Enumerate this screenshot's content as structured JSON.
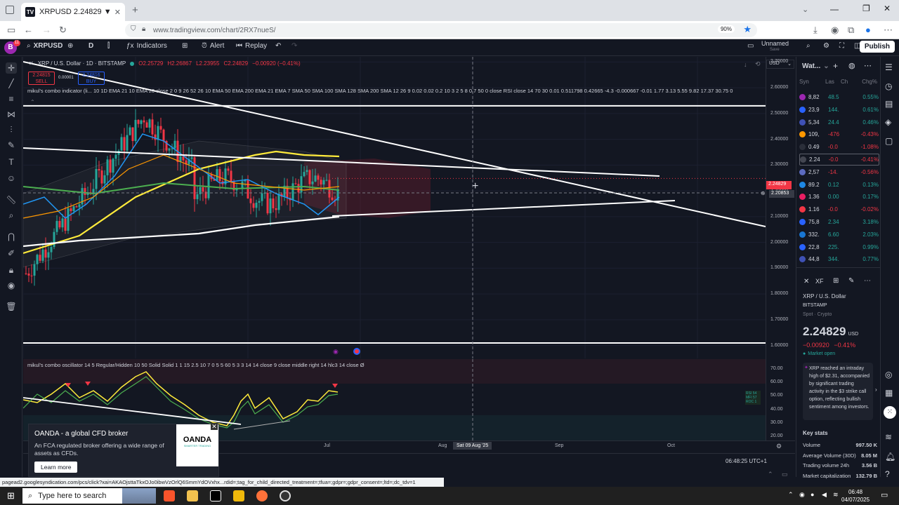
{
  "browser": {
    "tab_title": "XRPUSD 2.24829 ▼ −0.41% Un",
    "url": "www.tradingview.com/chart/2RX7nueS/",
    "zoom": "90%"
  },
  "toolbar": {
    "symbol": "XRPUSD",
    "interval": "D",
    "indicators": "Indicators",
    "alert": "Alert",
    "replay": "Replay",
    "layout_name": "Unnamed",
    "layout_sub": "Save",
    "publish": "Publish",
    "avatar": "B"
  },
  "legend": {
    "symbol_line": "XRP / U.S. Dollar · 1D · BITSTAMP",
    "o": "O2.25729",
    "h": "H2.26867",
    "l": "L2.23955",
    "c": "C2.24829",
    "chg": "−0.00920 (−0.41%)",
    "sell_price": "2.24815",
    "sell_label": "SELL",
    "spread": "0.00001",
    "buy_price": "2.24816",
    "buy_label": "BUY",
    "indicator": "mikul's combo indicator (li... 10 1D EMA 21 10 EMA 20 close 2 0 9 26 52 26 10 EMA 50 EMA 200 EMA 21 EMA 7 SMA 50 SMA 100 SMA 128 SMA 200 SMA 12 26 9 0.02 0.02 0.2 10 3 2 5 8 0.7 50 0 close RSI close 14 70 30 0.01 0.511798 0.42665 -4.3 -0.000667 -0.01 1.77 3.13 5.55 9.82 17.37 30.75 0",
    "oscillator": "mikul's combo oscillator 14 5 Regular/Hidden 10 50 Solid Solid 1 1 15 2.5 10 7 0 5 5 60 5 3 3 14 14 close 9 close middle right 14 hlc3 14 close  Ø",
    "currency": "USD",
    "osc_table": [
      "RSI  54",
      "MFI  57",
      "ROC  1"
    ]
  },
  "price_axis": {
    "labels": [
      "2.70000",
      "2.60000",
      "2.50000",
      "2.40000",
      "2.30000",
      "2.20000",
      "2.10000",
      "2.00000",
      "1.90000",
      "1.80000",
      "1.70000",
      "1.60000"
    ],
    "current": "2.24829",
    "crosshair": "2.20853",
    "osc_labels": [
      "70.00",
      "60.00",
      "50.00",
      "40.00",
      "30.00",
      "20.00"
    ]
  },
  "time_axis": {
    "labels": [
      "Jul",
      "Aug",
      "Sep",
      "Oct"
    ],
    "crosshair": "Sat 09 Aug '25",
    "clock": "06:48:25 UTC+1"
  },
  "chart_data": {
    "type": "line",
    "title": "XRP / U.S. Dollar · 1D · BITSTAMP",
    "ylim": [
      1.55,
      2.72
    ],
    "y_ticks": [
      2.7,
      2.6,
      2.5,
      2.4,
      2.3,
      2.2,
      2.1,
      2.0,
      1.9,
      1.8,
      1.7,
      1.6
    ],
    "x_ticks": [
      "Jul",
      "Aug",
      "Sep",
      "Oct"
    ],
    "horizontal_lines": [
      2.53,
      1.61
    ],
    "last_price": 2.24829
  },
  "watchlist": {
    "title": "Wat...",
    "headers": [
      "Syn",
      "Las",
      "Ch",
      "Chg%"
    ],
    "rows": [
      {
        "sym": "8,82",
        "last": "48.5",
        "chg": "0.55%",
        "color": "#9c27b0",
        "up": true
      },
      {
        "sym": "23,9",
        "last": "144.",
        "chg": "0.61%",
        "color": "#2962ff",
        "up": true
      },
      {
        "sym": "5,34",
        "last": "24.4",
        "chg": "0.46%",
        "color": "#3f51b5",
        "up": true
      },
      {
        "sym": "109,",
        "last": "-476",
        "chg": "-0.43%",
        "color": "#ff9800",
        "up": false
      },
      {
        "sym": "0.49",
        "last": "-0.0",
        "chg": "-1.08%",
        "color": "#2a2e39",
        "up": false
      },
      {
        "sym": "2.24",
        "last": "-0.0",
        "chg": "-0.41%",
        "color": "#434651",
        "up": false
      },
      {
        "sym": "2,57",
        "last": "-14.",
        "chg": "-0.56%",
        "color": "#5c6bc0",
        "up": false
      },
      {
        "sym": "89.2",
        "last": "0.12",
        "chg": "0.13%",
        "color": "#1e88e5",
        "up": true
      },
      {
        "sym": "1.36",
        "last": "0.00",
        "chg": "0.17%",
        "color": "#e91e63",
        "up": true
      },
      {
        "sym": "1.16",
        "last": "-0.0",
        "chg": "-0.02%",
        "color": "#f23645",
        "up": false
      },
      {
        "sym": "75,8",
        "last": "2.34",
        "chg": "3.18%",
        "color": "#2962ff",
        "up": true
      },
      {
        "sym": "332.",
        "last": "6.60",
        "chg": "2.03%",
        "color": "#1976d2",
        "up": true
      },
      {
        "sym": "22,8",
        "last": "225.",
        "chg": "0.99%",
        "color": "#2962ff",
        "up": true
      },
      {
        "sym": "44,8",
        "last": "344.",
        "chg": "0.77%",
        "color": "#3f51b5",
        "up": true
      }
    ]
  },
  "details": {
    "ticker": "XF",
    "name": "XRP / U.S. Dollar",
    "exchange": "BITSTAMP",
    "type": "Spot · Crypto",
    "price": "2.24829",
    "currency": "USD",
    "change": "−0.00920",
    "change_pct": "−0.41%",
    "market": "Market open",
    "news": "XRP reached an intraday high of $2.31, accompanied by significant trading activity in the $3 strike call option, reflecting bullish sentiment among investors.",
    "key_stats": "Key stats",
    "stats": [
      {
        "label": "Volume",
        "value": "997.50 K"
      },
      {
        "label": "Average Volume (30D)",
        "value": "8.05 M"
      },
      {
        "label": "Trading volume 24h",
        "value": "3.56 B"
      },
      {
        "label": "Market capitalization",
        "value": "132.79 B"
      }
    ]
  },
  "ad": {
    "title": "OANDA - a global CFD broker",
    "body": "An FCA regulated broker offering a wide range of assets as CFDs.",
    "cta": "Learn more",
    "logo": "OANDA",
    "logo_sub": "SMARTER TRADING"
  },
  "status_url": "pagead2.googlesyndication.com/pcs/click?xai=AKAOjsttaTkxOJo0ibwVzOrlQ6SmmYdOVxhx...rdid=;tag_for_child_directed_treatment=;tfua=;gdpr=;gdpr_consent=;ltd=;dc_tdv=1",
  "taskbar": {
    "search": "Type here to search",
    "time": "06:48",
    "date": "04/07/2025"
  }
}
